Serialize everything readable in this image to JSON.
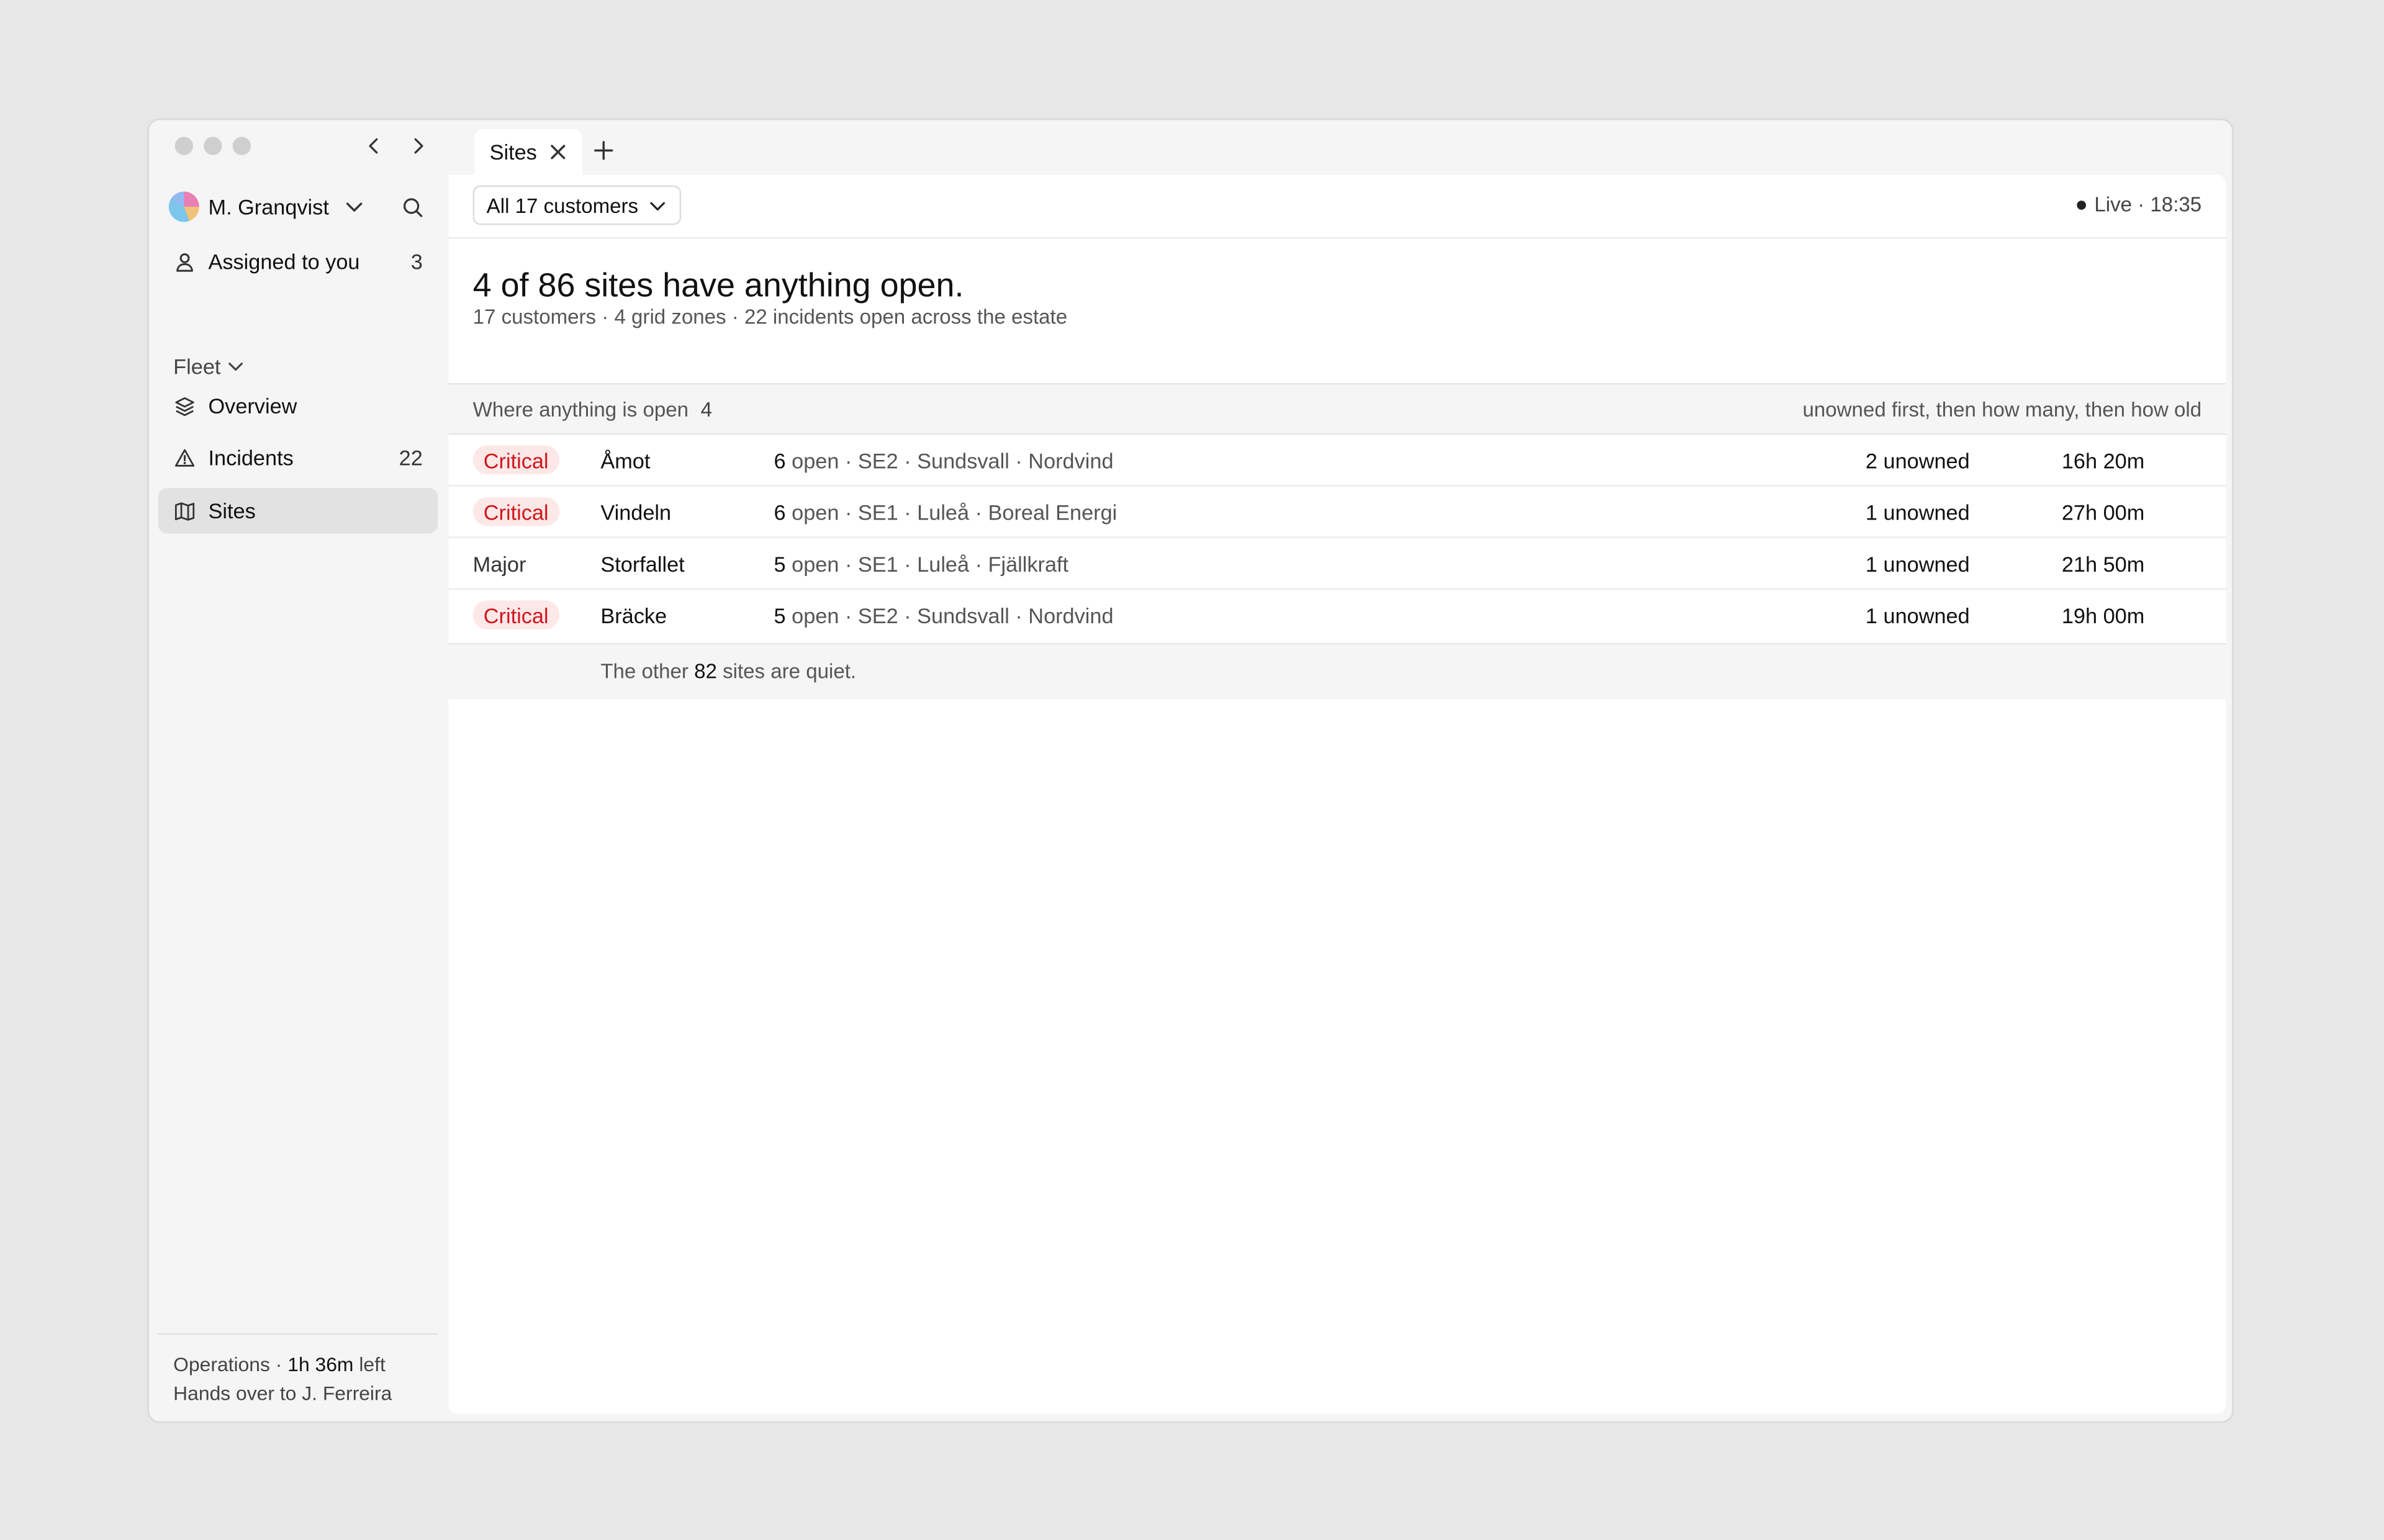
{
  "window": {
    "tab_label": "Sites"
  },
  "sidebar": {
    "user_name": "M. Granqvist",
    "assigned_label": "Assigned to you",
    "assigned_count": "3",
    "group_label": "Fleet",
    "items": [
      {
        "label": "Overview",
        "icon": "layers-icon",
        "count": ""
      },
      {
        "label": "Incidents",
        "icon": "warning-triangle-icon",
        "count": "22"
      },
      {
        "label": "Sites",
        "icon": "map-icon",
        "count": ""
      }
    ],
    "footer": {
      "shift_prefix": "Operations · ",
      "shift_time": "1h 36m",
      "shift_suffix": " left",
      "handover": "Hands over to J. Ferreira"
    }
  },
  "toolbar": {
    "filter_label": "All 17 customers",
    "live_label": "Live · 18:35"
  },
  "summary": {
    "headline": "4 of 86 sites have anything open.",
    "subline": "17 customers · 4 grid zones · 22 incidents open across the estate"
  },
  "list": {
    "header_label": "Where anything is open",
    "header_count": "4",
    "sort_note": "unowned first, then how many, then how old",
    "rows": [
      {
        "severity": "Critical",
        "site": "Åmot",
        "open_count": "6",
        "detail": " open · SE2 · Sundsvall · Nordvind",
        "unowned": "2 unowned",
        "age": "16h 20m"
      },
      {
        "severity": "Critical",
        "site": "Vindeln",
        "open_count": "6",
        "detail": " open · SE1 · Luleå · Boreal Energi",
        "unowned": "1 unowned",
        "age": "27h 00m"
      },
      {
        "severity": "Major",
        "site": "Storfallet",
        "open_count": "5",
        "detail": " open · SE1 · Luleå · Fjällkraft",
        "unowned": "1 unowned",
        "age": "21h 50m"
      },
      {
        "severity": "Critical",
        "site": "Bräcke",
        "open_count": "5",
        "detail": " open · SE2 · Sundsvall · Nordvind",
        "unowned": "1 unowned",
        "age": "19h 00m"
      }
    ],
    "quiet_prefix": "The other ",
    "quiet_count": "82",
    "quiet_suffix": " sites are quiet."
  },
  "colors": {
    "critical_text": "#d0161d",
    "critical_bg": "#fde8e8",
    "active_nav_bg": "#e2e2e2"
  }
}
